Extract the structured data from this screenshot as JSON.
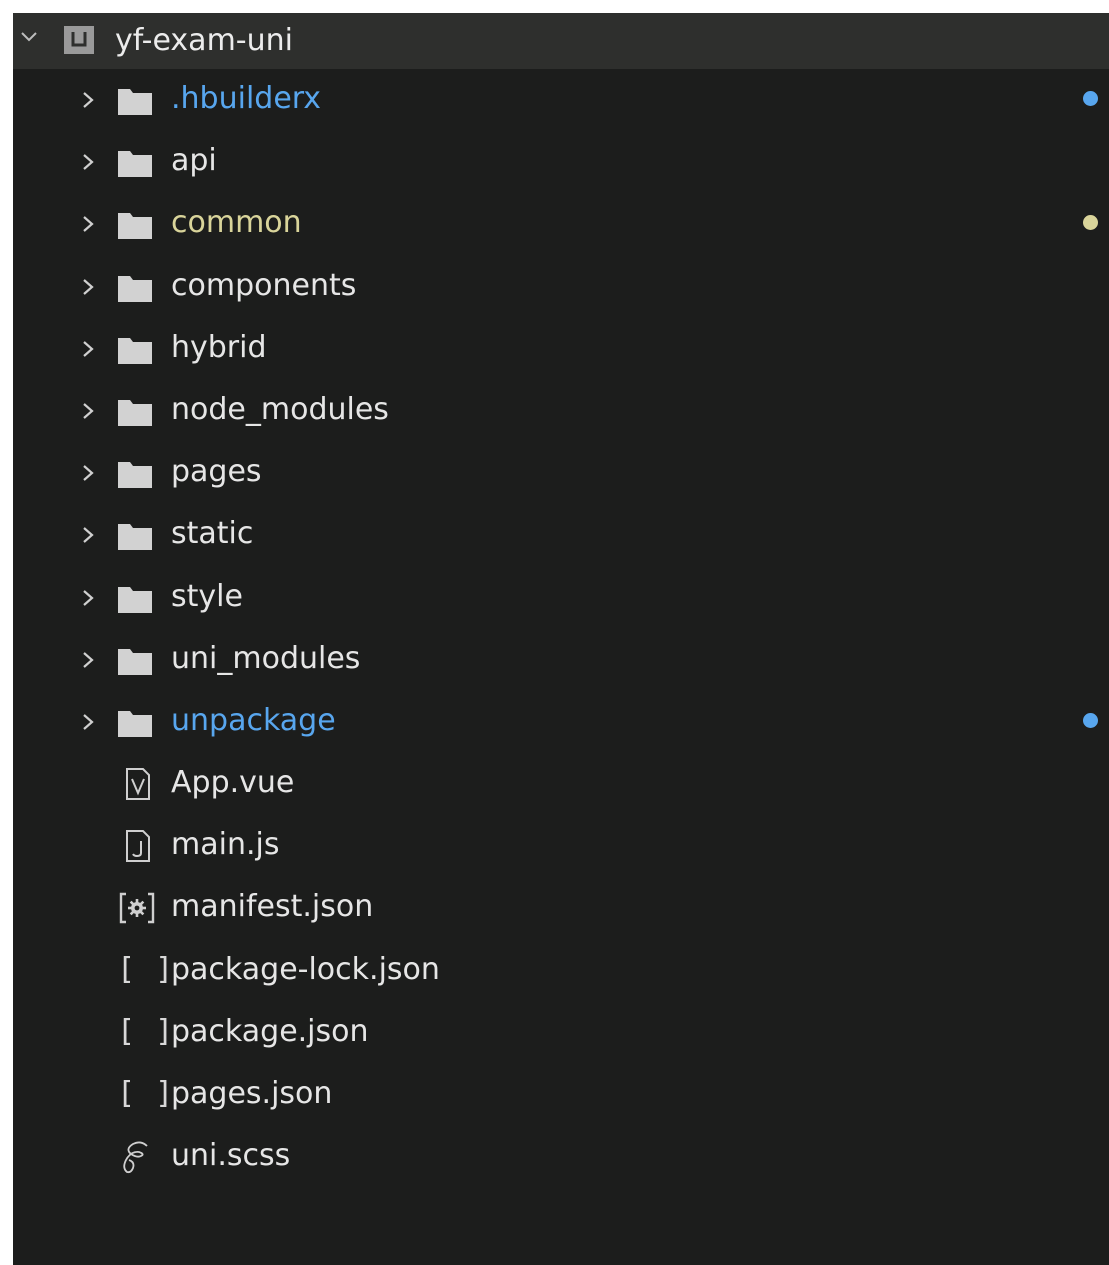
{
  "root": {
    "label": "yf-exam-uni",
    "expanded": true,
    "icon": "project-icon"
  },
  "colors": {
    "background": "#1c1d1c",
    "root_row": "#2e2f2d",
    "text": "#e6e6e6",
    "modified_blue": "#58a6ee",
    "modified_yellow": "#d9d49a"
  },
  "folders": [
    {
      "label": ".hbuilderx",
      "color": "#58a6ee",
      "dot": "#58a6ee"
    },
    {
      "label": "api",
      "color": "",
      "dot": ""
    },
    {
      "label": "common",
      "color": "#d9d49a",
      "dot": "#d9d49a"
    },
    {
      "label": "components",
      "color": "",
      "dot": ""
    },
    {
      "label": "hybrid",
      "color": "",
      "dot": ""
    },
    {
      "label": "node_modules",
      "color": "",
      "dot": ""
    },
    {
      "label": "pages",
      "color": "",
      "dot": ""
    },
    {
      "label": "static",
      "color": "",
      "dot": ""
    },
    {
      "label": "style",
      "color": "",
      "dot": ""
    },
    {
      "label": "uni_modules",
      "color": "",
      "dot": ""
    },
    {
      "label": "unpackage",
      "color": "#58a6ee",
      "dot": "#58a6ee"
    }
  ],
  "files": [
    {
      "label": "App.vue",
      "icon": "vue-file-icon"
    },
    {
      "label": "main.js",
      "icon": "js-file-icon"
    },
    {
      "label": "manifest.json",
      "icon": "manifest-file-icon"
    },
    {
      "label": "package-lock.json",
      "icon": "json-file-icon"
    },
    {
      "label": "package.json",
      "icon": "json-file-icon"
    },
    {
      "label": "pages.json",
      "icon": "json-file-icon"
    },
    {
      "label": "uni.scss",
      "icon": "scss-file-icon"
    }
  ]
}
